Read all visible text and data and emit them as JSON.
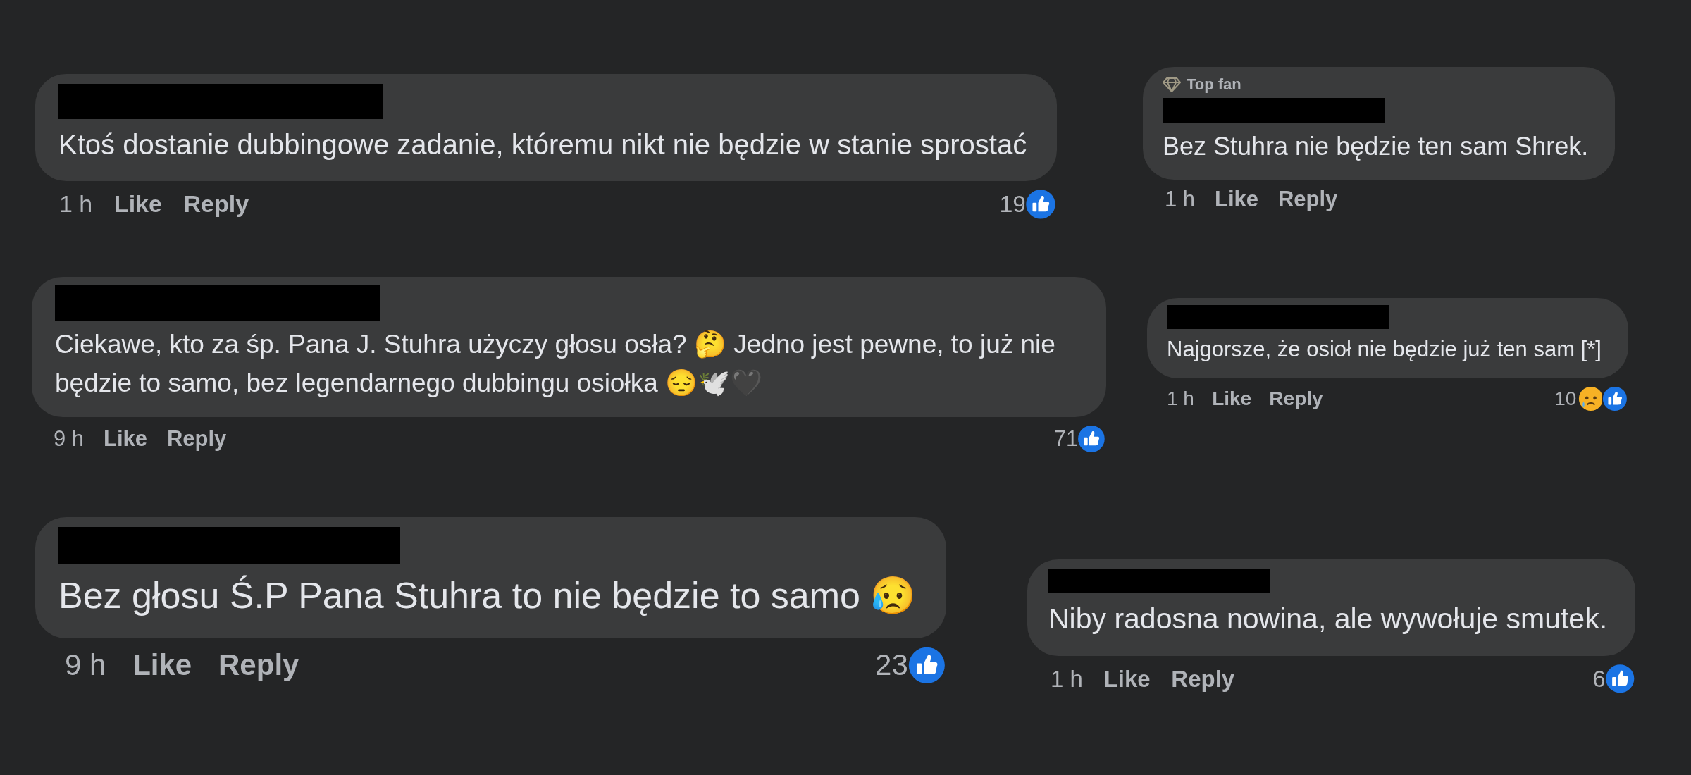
{
  "comments": [
    {
      "author": {
        "redacted": true
      },
      "text": "Ktoś dostanie dubbingowe zadanie, któremu nikt nie będzie w stanie sprostać",
      "time": "1 h",
      "actions": [
        "Like",
        "Reply"
      ],
      "reaction_count": "19",
      "reactions": [
        {
          "kind": "like"
        }
      ]
    },
    {
      "badge": "Top fan",
      "author": {
        "redacted": true
      },
      "text": "Bez Stuhra nie będzie ten sam Shrek.",
      "time": "1 h",
      "actions": [
        "Like",
        "Reply"
      ]
    },
    {
      "author": {
        "redacted": true
      },
      "text": "Ciekawe, kto za śp. Pana J. Stuhra użyczy głosu osła? 🤔 Jedno jest pewne, to już nie będzie to samo, bez legendarnego dubbingu osiołka 😔🕊️🖤",
      "time": "9 h",
      "actions": [
        "Like",
        "Reply"
      ],
      "reaction_count": "71",
      "reactions": [
        {
          "kind": "like"
        }
      ]
    },
    {
      "author": {
        "redacted": true
      },
      "text": "Najgorsze, że osioł nie będzie już ten sam [*]",
      "time": "1 h",
      "actions": [
        "Like",
        "Reply"
      ],
      "reaction_count": "10",
      "reactions": [
        {
          "kind": "sad"
        },
        {
          "kind": "like"
        }
      ]
    },
    {
      "author": {
        "redacted": true
      },
      "text": "Bez głosu Ś.P Pana Stuhra to nie będzie to samo 😥",
      "time": "9 h",
      "actions": [
        "Like",
        "Reply"
      ],
      "reaction_count": "23",
      "reactions": [
        {
          "kind": "like"
        }
      ]
    },
    {
      "author": {
        "redacted": true
      },
      "text": "Niby radosna nowina, ale wywołuje smutek.",
      "time": "1 h",
      "actions": [
        "Like",
        "Reply"
      ],
      "reaction_count": "6",
      "reactions": [
        {
          "kind": "like"
        }
      ]
    }
  ]
}
